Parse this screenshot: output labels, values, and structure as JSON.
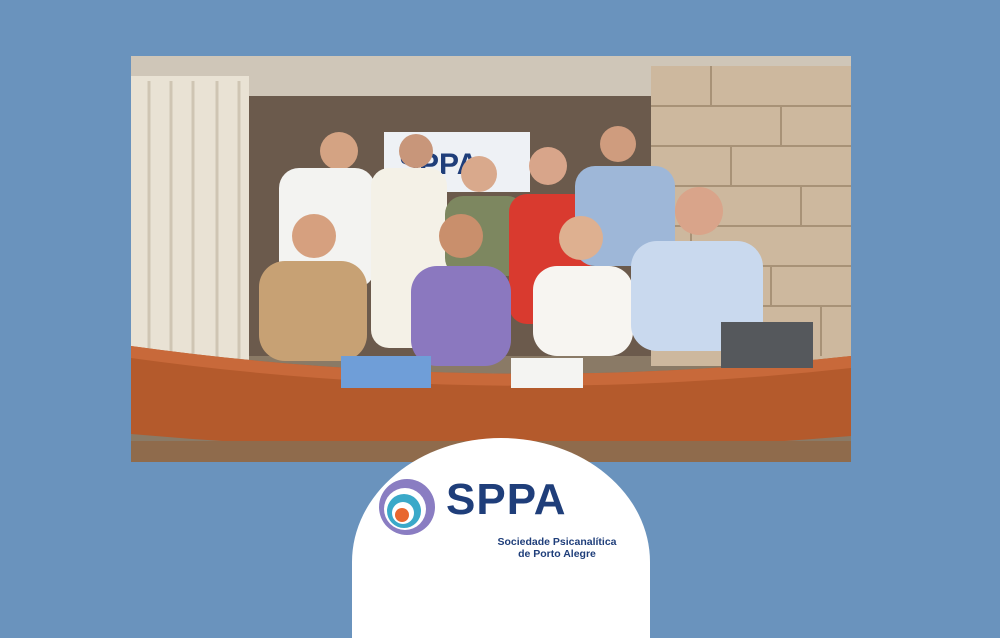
{
  "photo": {
    "alt": "",
    "banner_text": "SPPA",
    "banner_sub": "Sociedade Psicanalítica de Porto Alegre"
  },
  "logo": {
    "wordmark": "SPPA",
    "subtitle_line1": "Sociedade Psicanalítica",
    "subtitle_line2": "de Porto Alegre",
    "brand_color": "#1f3e7a",
    "accent_colors": [
      "#8a7dc2",
      "#3aa9c9",
      "#e8672f"
    ]
  },
  "page": {
    "background_color": "#6a93bd"
  }
}
